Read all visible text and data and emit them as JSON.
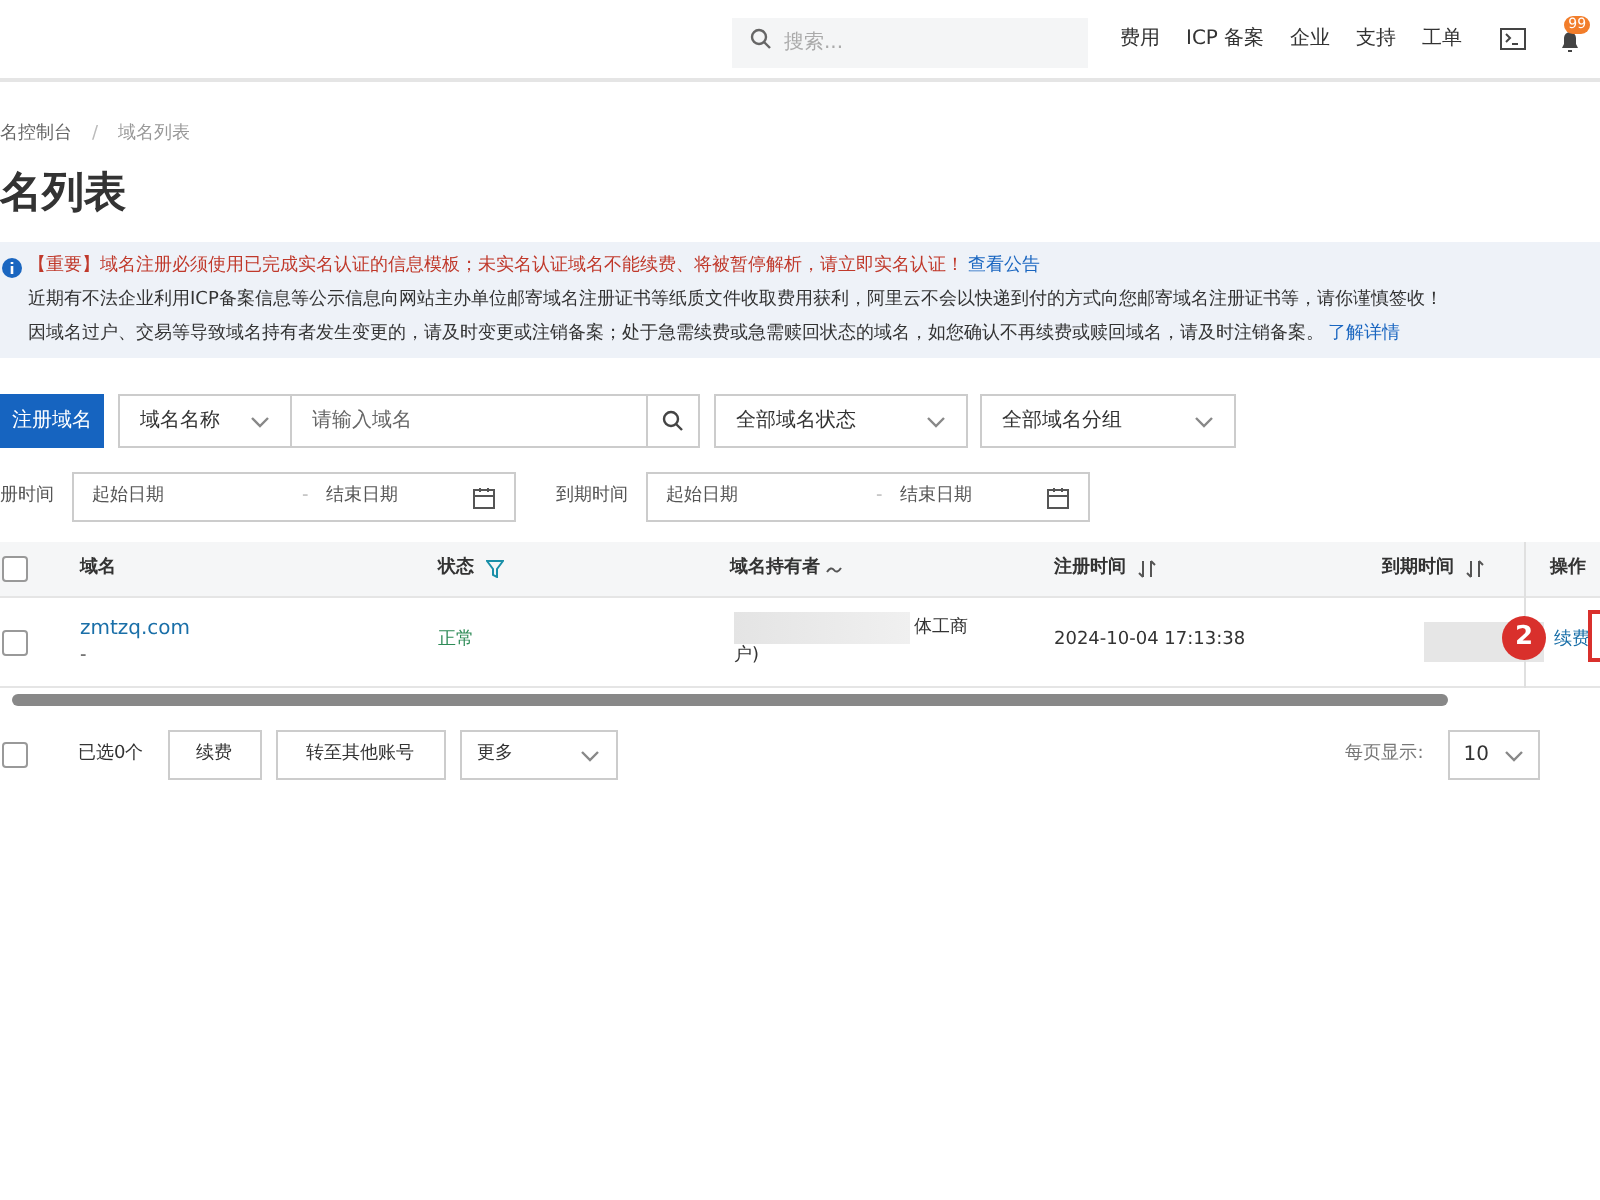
{
  "top_bar": {
    "search": {
      "placeholder": "搜索..."
    },
    "nav": [
      "费用",
      "ICP 备案",
      "企业",
      "支持",
      "工单"
    ],
    "notification_count": "99"
  },
  "breadcrumb": [
    "名控制台",
    "/",
    "域名列表"
  ],
  "title": "名列表",
  "notice": {
    "lines": [
      {
        "kind": "important",
        "text": "【重要】域名注册必须使用已完成实名认证的信息模板；未实名认证域名不能续费、将被暂停解析，请立即实名认证！",
        "link": "查看公告"
      },
      {
        "kind": "plain",
        "text": "近期有不法企业利用ICP备案信息等公示信息向网站主办单位邮寄域名注册证书等纸质文件收取费用获利，阿里云不会以快递到付的方式向您邮寄域名注册证书等，请你谨慎签收！"
      },
      {
        "kind": "plain",
        "text": "因域名过户、交易等导致域名持有者发生变更的，请及时变更或注销备案；处于急需续费或急需赎回状态的域名，如您确认不再续费或赎回域名，请及时注销备案。",
        "link": "了解详情"
      }
    ]
  },
  "filters": {
    "register_button": "注册域名",
    "field_type": "域名名称",
    "search": {
      "placeholder": "请输入域名"
    },
    "status_select": "全部域名状态",
    "group_select": "全部域名分组",
    "date_ranges": [
      {
        "label": "册时间",
        "start_placeholder": "起始日期",
        "separator": "-",
        "end_placeholder": "结束日期"
      },
      {
        "label": "到期时间",
        "start_placeholder": "起始日期",
        "separator": "-",
        "end_placeholder": "结束日期"
      }
    ]
  },
  "table": {
    "select_all": false,
    "columns": [
      "域名",
      "状态",
      "域名持有者",
      "注册时间",
      "到期时间",
      "操作"
    ],
    "rows": [
      {
        "selected": false,
        "domain": "zmtzq.com",
        "domain_note": "-",
        "status": "正常",
        "holder_visible": [
          "体工商",
          "户)"
        ],
        "registered": "2024-10-04 17:13:38",
        "action": "续费",
        "step_badge": "2"
      }
    ]
  },
  "footer": {
    "selected_all": false,
    "selected_count": "已选0个",
    "buttons": [
      "续费",
      "转至其他账号"
    ],
    "more_select": "更多",
    "page_size_label": "每页显示:",
    "page_size": "10"
  }
}
